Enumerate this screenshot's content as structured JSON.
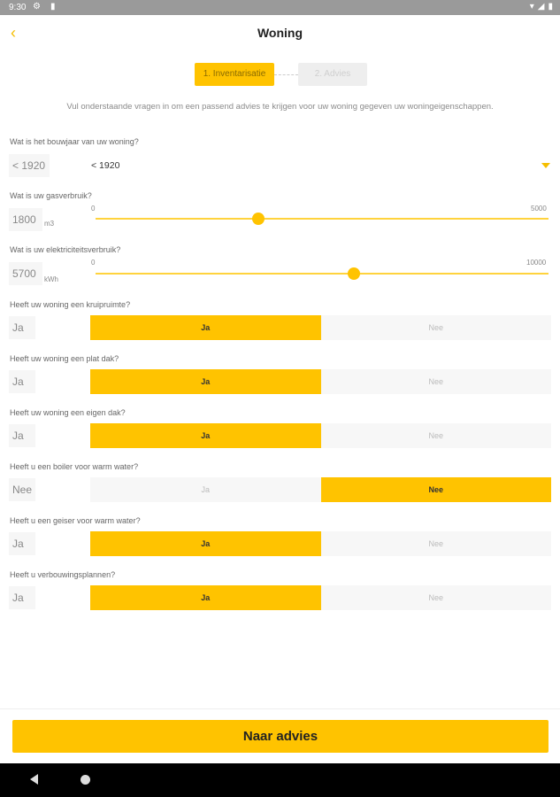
{
  "status_bar": {
    "time": "9:30",
    "icons": [
      "settings-icon",
      "sim-card-icon",
      "wifi-icon",
      "signal-icon",
      "battery-icon"
    ]
  },
  "header": {
    "title": "Woning",
    "back_icon": "chevron-left-icon"
  },
  "stepper": {
    "steps": [
      "1. Inventarisatie",
      "2. Advies"
    ],
    "active_index": 0
  },
  "intro": "Vul onderstaande vragen in om een passend advies te krijgen voor uw woning gegeven uw woningeigenschappen.",
  "questions": {
    "bouwjaar": {
      "label": "Wat is het bouwjaar van uw woning?",
      "value": "< 1920",
      "selected": "< 1920"
    },
    "gas": {
      "label": "Wat is uw gasverbruik?",
      "value": "1800",
      "unit": "m3",
      "min": "0",
      "max": "5000",
      "slider_value": 1800
    },
    "elektriciteit": {
      "label": "Wat is uw elektriciteitsverbruik?",
      "value": "5700",
      "unit": "kWh",
      "min": "0",
      "max": "10000",
      "slider_value": 5700
    },
    "kruipruimte": {
      "label": "Heeft uw woning een kruipruimte?",
      "value": "Ja",
      "selected": "Ja"
    },
    "plat_dak": {
      "label": "Heeft uw woning een plat dak?",
      "value": "Ja",
      "selected": "Ja"
    },
    "eigen_dak": {
      "label": "Heeft uw woning een eigen dak?",
      "value": "Ja",
      "selected": "Ja"
    },
    "boiler": {
      "label": "Heeft u een boiler voor warm water?",
      "value": "Nee",
      "selected": "Nee"
    },
    "geiser": {
      "label": "Heeft u een geiser voor warm water?",
      "value": "Ja",
      "selected": "Ja"
    },
    "verbouwing": {
      "label": "Heeft u verbouwingsplannen?",
      "value": "Ja",
      "selected": "Ja"
    }
  },
  "options": {
    "yes": "Ja",
    "no": "Nee"
  },
  "cta": "Naar advies",
  "colors": {
    "accent": "#FFC300",
    "inactive": "#f7f7f7"
  }
}
